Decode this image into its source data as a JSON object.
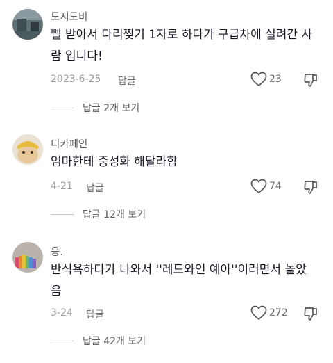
{
  "comments": [
    {
      "username": "도지도비",
      "text_lines": [
        "삘 받아서 다리찢기 1자로 하다가 구급차에 실려간 사",
        "람 입니다!"
      ],
      "date": "2023-6-25",
      "reply_label": "답글",
      "likes": "23",
      "view_replies": "답글 2개 보기"
    },
    {
      "username": "디카페인",
      "text_lines": [
        "엄마한테 중성화 해달라함"
      ],
      "date": "4-21",
      "reply_label": "답글",
      "likes": "74",
      "view_replies": "답글 12개 보기"
    },
    {
      "username": "응.",
      "text_lines": [
        "반식욕하다가 나와서 ''레드와인 예아''이러면서 놀았",
        "음"
      ],
      "date": "3-24",
      "reply_label": "답글",
      "likes": "272",
      "view_replies": "답글 42개 보기"
    }
  ]
}
